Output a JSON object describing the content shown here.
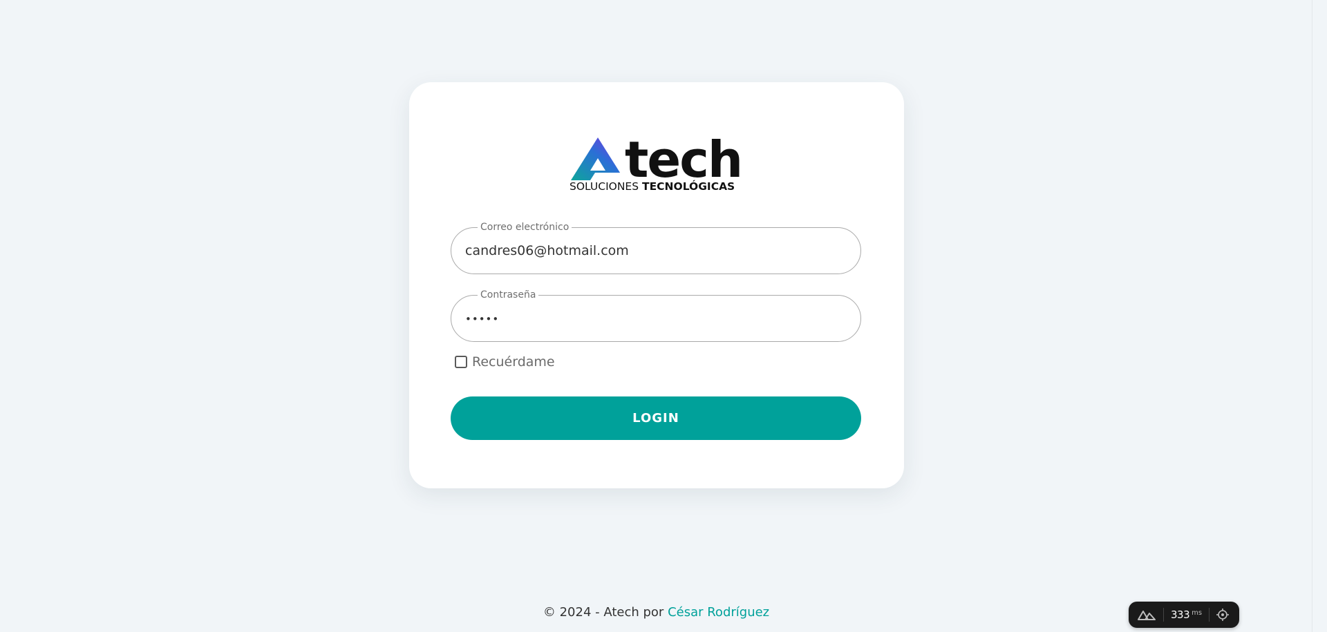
{
  "brand": {
    "logo_text": "Atech",
    "tagline_regular": "SOLUCIONES",
    "tagline_bold": "TECNOLÓGICAS"
  },
  "form": {
    "email_label": "Correo electrónico",
    "email_value": "candres06@hotmail.com",
    "password_label": "Contraseña",
    "password_value": "•••••",
    "remember_label": "Recuérdame",
    "remember_checked": false,
    "login_button": "LOGIN"
  },
  "footer": {
    "text": "© 2024 - Atech por",
    "author_link": "César Rodríguez"
  },
  "devtools": {
    "ms_value": "333",
    "ms_unit": "ms"
  },
  "colors": {
    "accent": "#00a19a",
    "background": "#f1f5f8",
    "card": "#ffffff"
  },
  "icons": {
    "logo_mark": "triangle-gradient-icon",
    "devtools_logo": "nuxt-icon",
    "devtools_target": "crosshair-icon"
  }
}
